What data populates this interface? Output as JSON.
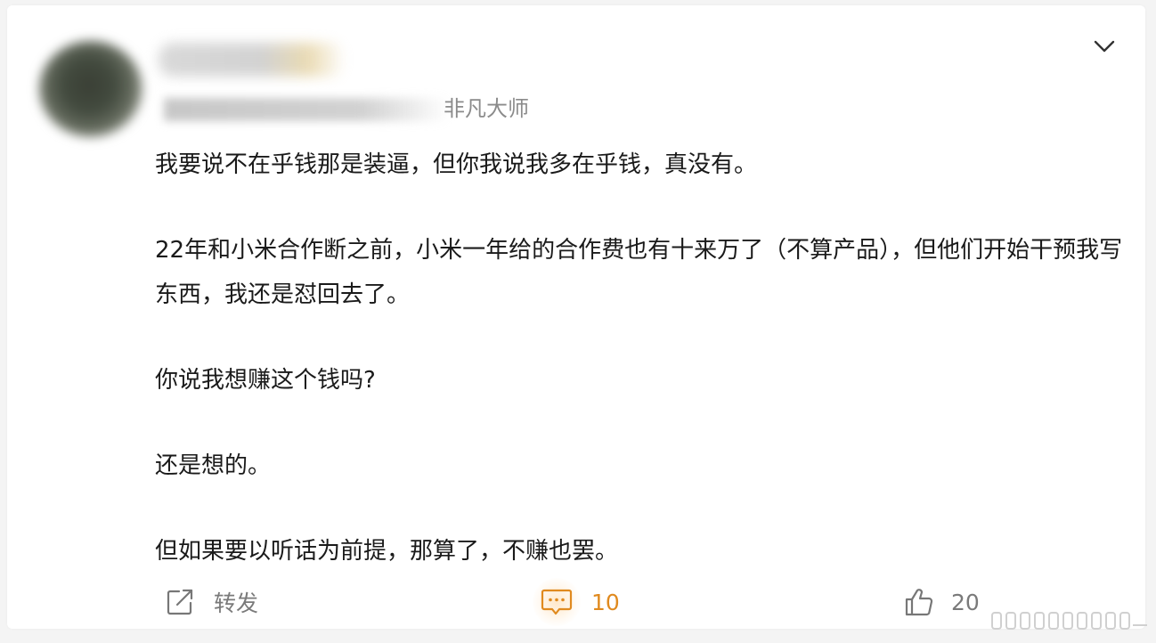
{
  "post": {
    "meta_source": "非凡大师",
    "paragraphs": [
      "我要说不在乎钱那是装逼，但你我说我多在乎钱，真没有。",
      "22年和小米合作断之前，小米一年给的合作费也有十来万了（不算产品），但他们开始干预我写东西，我还是怼回去了。",
      "你说我想赚这个钱吗?",
      "还是想的。",
      "但如果要以听话为前提，那算了，不赚也罢。"
    ]
  },
  "actions": {
    "repost_label": "转发",
    "comment_count": "10",
    "like_count": "20"
  },
  "icons": {
    "menu": "chevron-down-icon",
    "repost": "share-arrow-icon",
    "comment": "comment-bubble-icon",
    "like": "thumbs-up-icon"
  },
  "colors": {
    "accent": "#e08a1f",
    "text": "#1a1a1a",
    "muted": "#7a7a7a"
  }
}
